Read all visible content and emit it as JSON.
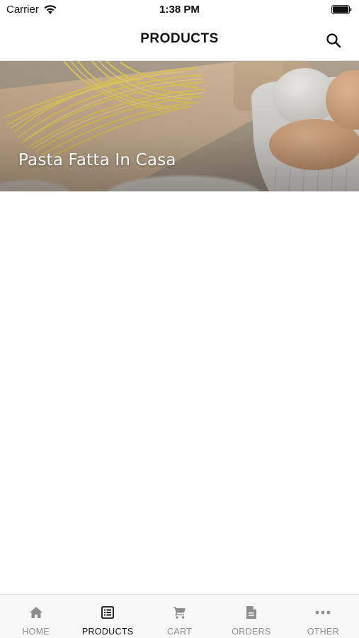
{
  "status_bar": {
    "carrier": "Carrier",
    "time": "1:38 PM"
  },
  "nav": {
    "title": "PRODUCTS",
    "search_icon": "search-icon"
  },
  "categories": [
    {
      "title": "Pasta Fatta In Casa",
      "image": "fresh-pasta-and-eggs-photo"
    }
  ],
  "tabs": [
    {
      "label": "HOME",
      "icon": "home-icon",
      "active": false
    },
    {
      "label": "PRODUCTS",
      "icon": "list-icon",
      "active": true
    },
    {
      "label": "CART",
      "icon": "cart-icon",
      "active": false
    },
    {
      "label": "ORDERS",
      "icon": "document-icon",
      "active": false
    },
    {
      "label": "OTHER",
      "icon": "more-icon",
      "active": false
    }
  ],
  "colors": {
    "active_tab": "#111111",
    "inactive_tab": "#8e8e8e",
    "tab_bar_background": "#f8f8f8"
  }
}
